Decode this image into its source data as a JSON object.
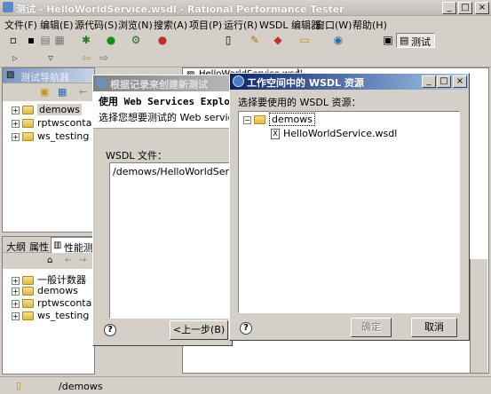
{
  "window": {
    "title": "测试 - HelloWorldService.wsdl - Rational Performance Tester",
    "min": "_",
    "max": "□",
    "close": "×"
  },
  "menubar": [
    "文件(F)",
    "编辑(E)",
    "源代码(S)",
    "浏览(N)",
    "搜索(A)",
    "项目(P)",
    "运行(R)",
    "WSDL 编辑器",
    "窗口(W)",
    "帮助(H)"
  ],
  "toolbar": {
    "perspective_label": "测试"
  },
  "test_navigator": {
    "title": "测试导航器",
    "items": [
      "demows",
      "rptwscontainer",
      "ws_testing"
    ]
  },
  "editor_tab": {
    "label": "HelloWorldService.wsdl"
  },
  "bottom_panel": {
    "tabs": [
      "大纲",
      "属性",
      "性能测"
    ],
    "items": [
      "一般计数器",
      "demows",
      "rptwscontainer",
      "ws_testing"
    ]
  },
  "status": {
    "path": "/demows"
  },
  "wizard": {
    "title": "根据记录来创建新测试",
    "heading": "使用 Web Services Explorer",
    "description": "选择您想要测试的 Web service 的 W",
    "wsdl_label": "WSDL 文件：",
    "wsdl_value": "/demows/HelloWorldService.wsdl",
    "back_button": "<上一步(B)",
    "help": "?"
  },
  "resource_dialog": {
    "title": "工作空间中的 WSDL 资源",
    "prompt": "选择要使用的 WSDL 资源：",
    "tree": {
      "root": "demows",
      "child": "HelloWorldService.wsdl"
    },
    "ok_button": "确定",
    "cancel_button": "取消",
    "help": "?",
    "min": "_",
    "max": "□",
    "close": "×"
  }
}
